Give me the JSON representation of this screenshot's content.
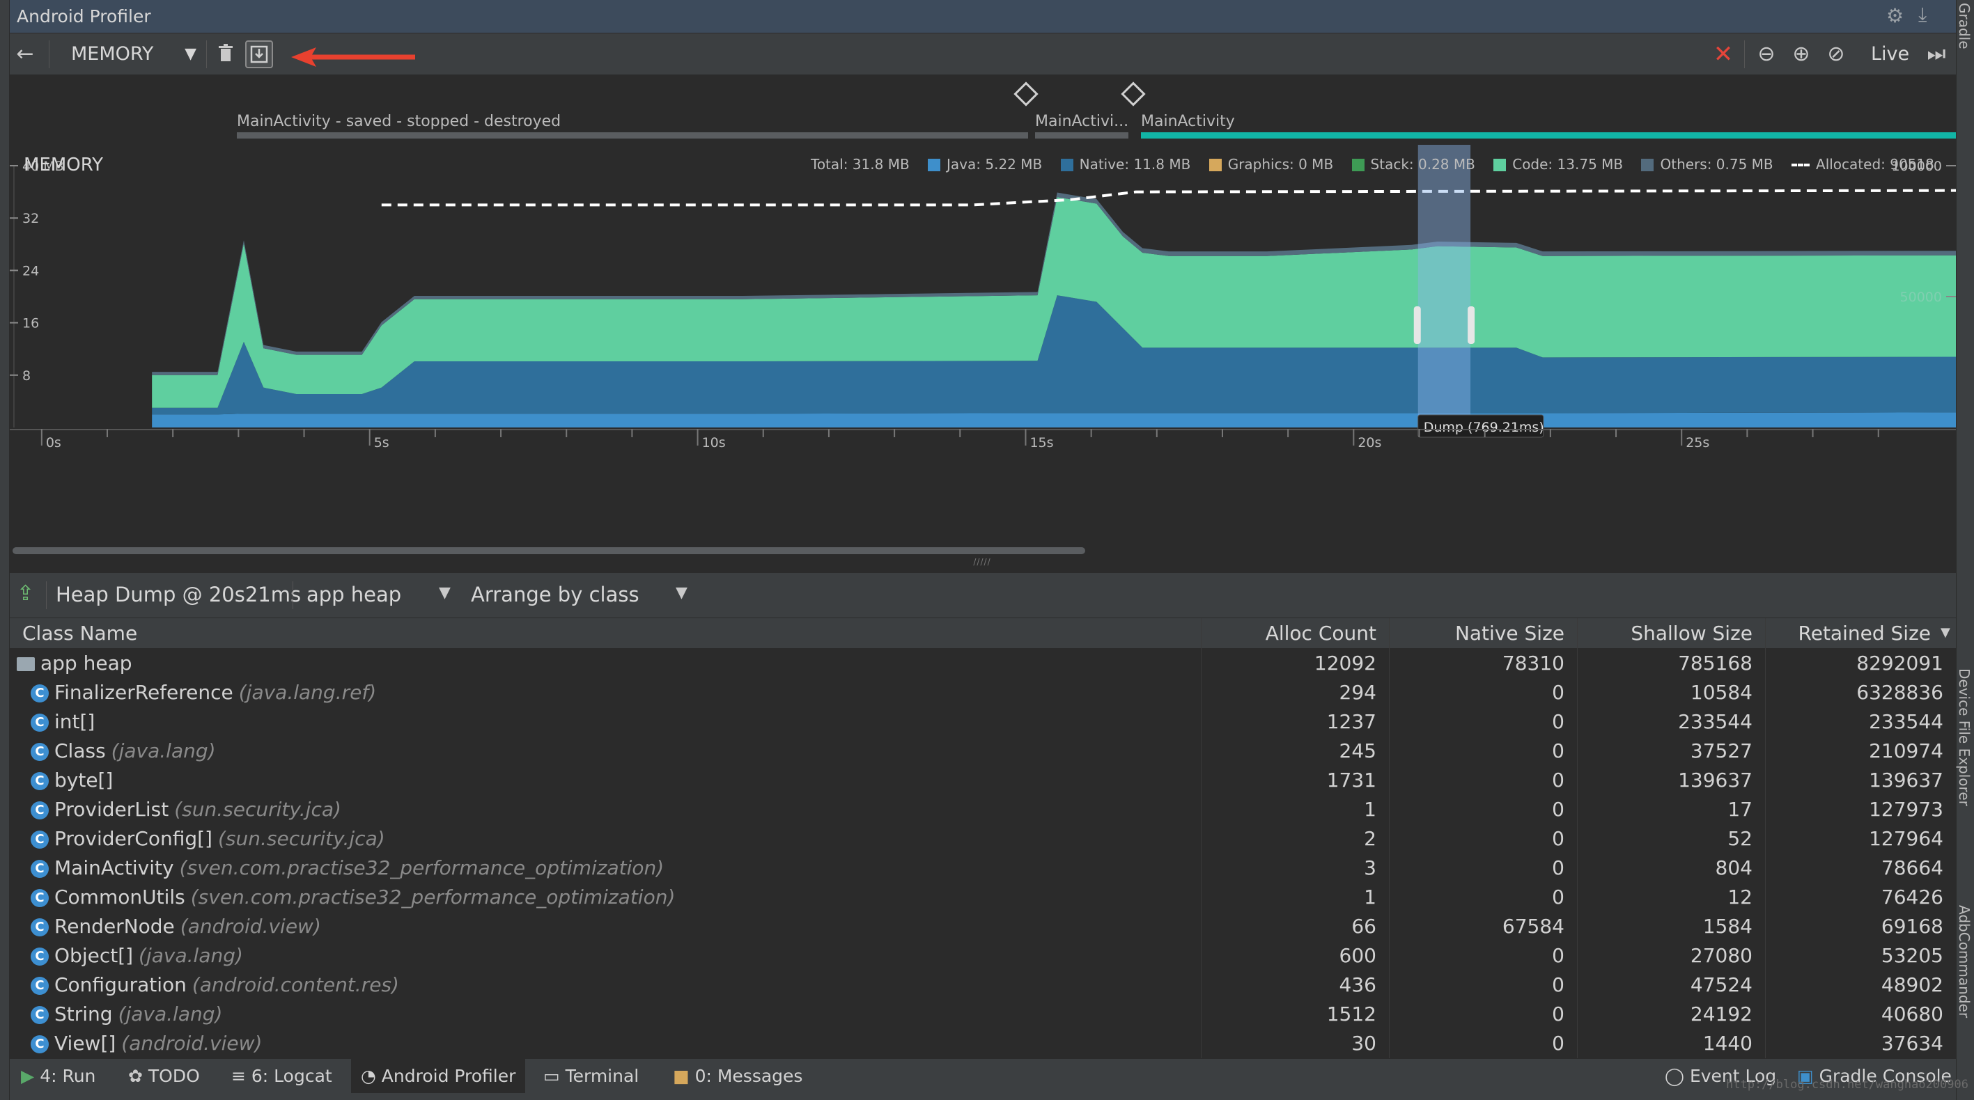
{
  "window": {
    "title": "Android Profiler"
  },
  "side_tabs": {
    "gradle": "Gradle",
    "device_file_explorer": "Device File Explorer",
    "adb_commander": "AdbCommander"
  },
  "toolbar": {
    "profiler": "MEMORY",
    "live": "Live"
  },
  "events": {
    "activities": [
      {
        "label": "MainActivity - saved - stopped - destroyed",
        "state": "destroyed"
      },
      {
        "label": "MainActivi...",
        "state": "destroyed"
      },
      {
        "label": "MainActivity",
        "state": "active"
      }
    ]
  },
  "memory": {
    "title": "MEMORY",
    "legend": {
      "total": "Total:  31.8 MB",
      "java": "Java: 5.22 MB",
      "native": "Native:  11.8 MB",
      "graphics": "Graphics: 0 MB",
      "stack": "Stack: 0.28 MB",
      "code": "Code:  13.75 MB",
      "others": "Others: 0.75 MB",
      "allocated": "Allocated: 90518"
    },
    "colors": {
      "java": "#3e8fcb",
      "native": "#2f6f9b",
      "graphics": "#d6a85c",
      "stack": "#3e9b55",
      "code": "#5fcf9f",
      "others": "#536b7d",
      "allocated": "#ffffff"
    },
    "left_axis_labels": [
      "40 MB",
      "32",
      "24",
      "16",
      "8"
    ],
    "right_axis_labels": [
      "100000",
      "50000"
    ],
    "time_labels": [
      "0s",
      "5s",
      "10s",
      "15s",
      "20s",
      "25s"
    ],
    "dump_label": "Dump (769.21ms)"
  },
  "chart_data": {
    "type": "area",
    "title": "MEMORY",
    "xlabel": "",
    "ylabel": "",
    "x_unit": "s",
    "xlim": [
      0,
      28.5
    ],
    "ylim": [
      0,
      40
    ],
    "y_unit": "MB",
    "y2lim": [
      0,
      100000
    ],
    "x": [
      1,
      2,
      2.4,
      2.7,
      3.2,
      4.2,
      4.5,
      5,
      10,
      14.5,
      14.8,
      15.4,
      15.8,
      16.1,
      16.5,
      18,
      20.2,
      20.6,
      21.8,
      22.2,
      28.5
    ],
    "series": [
      {
        "name": "Java",
        "values": [
          2,
          2,
          2.1,
          2.1,
          2.1,
          2.1,
          2.1,
          2.1,
          2.1,
          2.2,
          2.2,
          2.2,
          2.2,
          2.2,
          2.2,
          2.2,
          2.2,
          2.2,
          2.2,
          2.2,
          2.3
        ]
      },
      {
        "name": "Native",
        "values": [
          1,
          1,
          11,
          4,
          3,
          3,
          4,
          8,
          8,
          8,
          18,
          17,
          13,
          10,
          10,
          10,
          10,
          10,
          10,
          8.5,
          8.5
        ]
      },
      {
        "name": "Code",
        "values": [
          5,
          5,
          15,
          6,
          6,
          6,
          9.5,
          9.5,
          9.5,
          10,
          15,
          15,
          14,
          14.5,
          14,
          14,
          15,
          15.5,
          15.3,
          15.5,
          15.5
        ]
      },
      {
        "name": "Others",
        "values": [
          0.5,
          0.5,
          0.5,
          0.5,
          0.5,
          0.5,
          0.5,
          0.5,
          0.5,
          0.5,
          0.7,
          0.7,
          0.7,
          0.7,
          0.7,
          0.7,
          0.7,
          0.7,
          0.7,
          0.7,
          0.7
        ]
      }
    ],
    "allocated": {
      "x": [
        4.5,
        13.5,
        15,
        16,
        28.5
      ],
      "values": [
        85000,
        85000,
        87000,
        90000,
        90518
      ]
    },
    "selection": {
      "start": 20.3,
      "end": 21.1,
      "label": "Dump (769.21ms)"
    }
  },
  "heap": {
    "title": "Heap Dump @ 20s21ms",
    "heap_select": "app heap",
    "arrange_select": "Arrange by class",
    "columns": [
      "Class Name",
      "Alloc Count",
      "Native Size",
      "Shallow Size",
      "Retained Size"
    ],
    "rows": [
      {
        "name": "app heap",
        "pkg": "",
        "alloc": "12092",
        "native": "78310",
        "shallow": "785168",
        "retained": "8292091",
        "root": true
      },
      {
        "name": "FinalizerReference",
        "pkg": "(java.lang.ref)",
        "alloc": "294",
        "native": "0",
        "shallow": "10584",
        "retained": "6328836"
      },
      {
        "name": "int[]",
        "pkg": "",
        "alloc": "1237",
        "native": "0",
        "shallow": "233544",
        "retained": "233544"
      },
      {
        "name": "Class",
        "pkg": "(java.lang)",
        "alloc": "245",
        "native": "0",
        "shallow": "37527",
        "retained": "210974"
      },
      {
        "name": "byte[]",
        "pkg": "",
        "alloc": "1731",
        "native": "0",
        "shallow": "139637",
        "retained": "139637"
      },
      {
        "name": "ProviderList",
        "pkg": "(sun.security.jca)",
        "alloc": "1",
        "native": "0",
        "shallow": "17",
        "retained": "127973"
      },
      {
        "name": "ProviderConfig[]",
        "pkg": "(sun.security.jca)",
        "alloc": "2",
        "native": "0",
        "shallow": "52",
        "retained": "127964"
      },
      {
        "name": "MainActivity",
        "pkg": "(sven.com.practise32_performance_optimization)",
        "alloc": "3",
        "native": "0",
        "shallow": "804",
        "retained": "78664"
      },
      {
        "name": "CommonUtils",
        "pkg": "(sven.com.practise32_performance_optimization)",
        "alloc": "1",
        "native": "0",
        "shallow": "12",
        "retained": "76426"
      },
      {
        "name": "RenderNode",
        "pkg": "(android.view)",
        "alloc": "66",
        "native": "67584",
        "shallow": "1584",
        "retained": "69168"
      },
      {
        "name": "Object[]",
        "pkg": "(java.lang)",
        "alloc": "600",
        "native": "0",
        "shallow": "27080",
        "retained": "53205"
      },
      {
        "name": "Configuration",
        "pkg": "(android.content.res)",
        "alloc": "436",
        "native": "0",
        "shallow": "47524",
        "retained": "48902"
      },
      {
        "name": "String",
        "pkg": "(java.lang)",
        "alloc": "1512",
        "native": "0",
        "shallow": "24192",
        "retained": "40680"
      },
      {
        "name": "View[]",
        "pkg": "(android.view)",
        "alloc": "30",
        "native": "0",
        "shallow": "1440",
        "retained": "37634"
      }
    ]
  },
  "bottom_bar": {
    "run": "4: Run",
    "todo": "TODO",
    "logcat": "6: Logcat",
    "profiler": "Android Profiler",
    "terminal": "Terminal",
    "messages": "0: Messages",
    "event_log": "Event Log",
    "gradle_console": "Gradle Console"
  },
  "watermark": "http://blog.csdn.net/wanghao200906"
}
